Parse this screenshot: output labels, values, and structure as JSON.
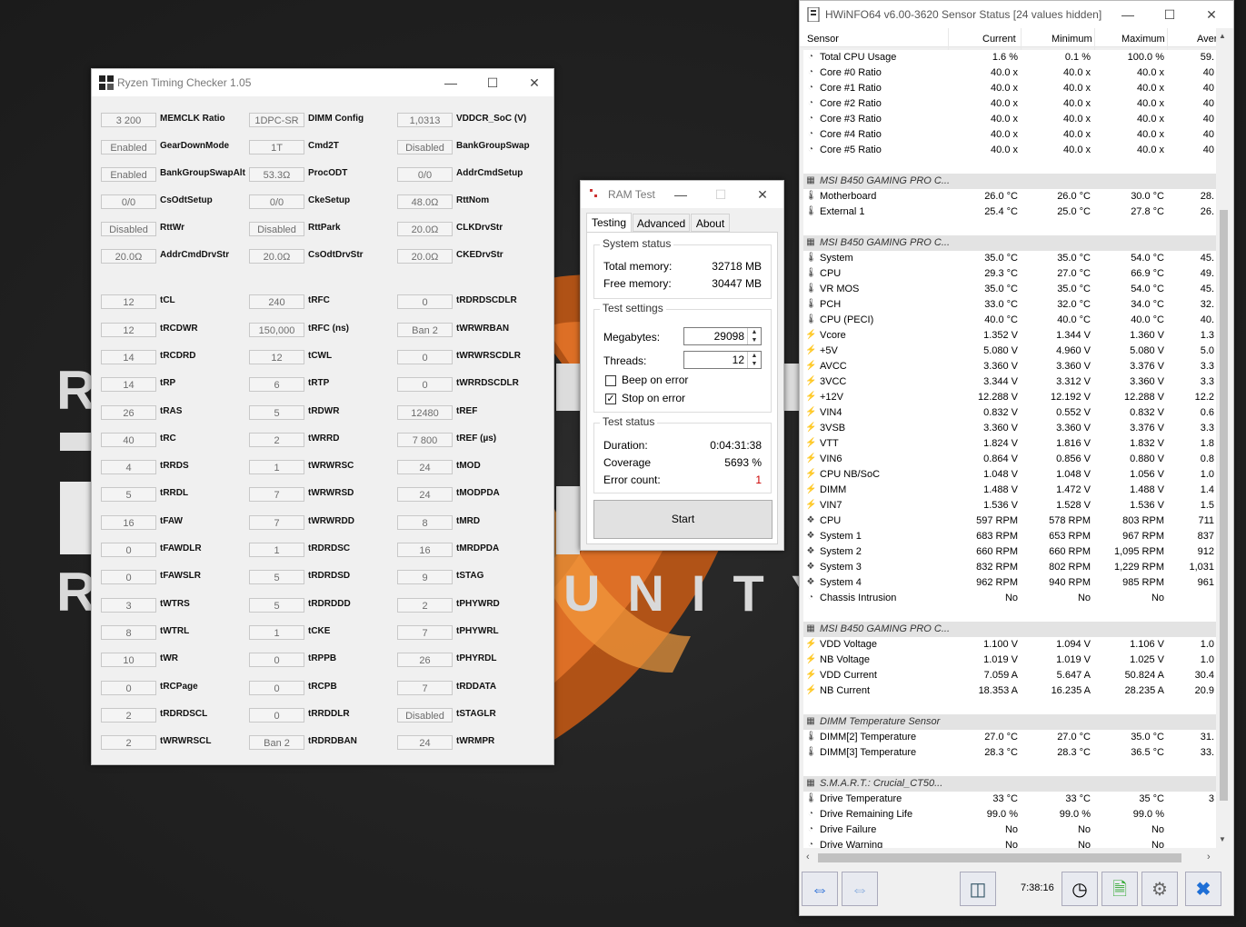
{
  "rtc": {
    "title": "Ryzen Timing Checker 1.05",
    "cells": [
      {
        "value": "3 200",
        "label": "MEMCLK Ratio"
      },
      {
        "value": "1DPC-SR",
        "label": "DIMM Config"
      },
      {
        "value": "1,0313",
        "label": "VDDCR_SoC (V)"
      },
      {
        "value": "Enabled",
        "label": "GearDownMode"
      },
      {
        "value": "1T",
        "label": "Cmd2T"
      },
      {
        "value": "Disabled",
        "label": "BankGroupSwap"
      },
      {
        "value": "Enabled",
        "label": "BankGroupSwapAlt"
      },
      {
        "value": "53.3Ω",
        "label": "ProcODT"
      },
      {
        "value": "0/0",
        "label": "AddrCmdSetup"
      },
      {
        "value": "0/0",
        "label": "CsOdtSetup"
      },
      {
        "value": "0/0",
        "label": "CkeSetup"
      },
      {
        "value": "48.0Ω",
        "label": "RttNom"
      },
      {
        "value": "Disabled",
        "label": "RttWr"
      },
      {
        "value": "Disabled",
        "label": "RttPark"
      },
      {
        "value": "20.0Ω",
        "label": "CLKDrvStr"
      },
      {
        "value": "20.0Ω",
        "label": "AddrCmdDrvStr"
      },
      {
        "value": "20.0Ω",
        "label": "CsOdtDrvStr"
      },
      {
        "value": "20.0Ω",
        "label": "CKEDrvStr"
      },
      {
        "value": "12",
        "label": "tCL"
      },
      {
        "value": "240",
        "label": "tRFC"
      },
      {
        "value": "0",
        "label": "tRDRDSCDLR"
      },
      {
        "value": "12",
        "label": "tRCDWR"
      },
      {
        "value": "150,000",
        "label": "tRFC (ns)"
      },
      {
        "value": "Ban 2",
        "label": "tWRWRBAN"
      },
      {
        "value": "14",
        "label": "tRCDRD"
      },
      {
        "value": "12",
        "label": "tCWL"
      },
      {
        "value": "0",
        "label": "tWRWRSCDLR"
      },
      {
        "value": "14",
        "label": "tRP"
      },
      {
        "value": "6",
        "label": "tRTP"
      },
      {
        "value": "0",
        "label": "tWRRDSCDLR"
      },
      {
        "value": "26",
        "label": "tRAS"
      },
      {
        "value": "5",
        "label": "tRDWR"
      },
      {
        "value": "12480",
        "label": "tREF"
      },
      {
        "value": "40",
        "label": "tRC"
      },
      {
        "value": "2",
        "label": "tWRRD"
      },
      {
        "value": "7 800",
        "label": "tREF (µs)"
      },
      {
        "value": "4",
        "label": "tRRDS"
      },
      {
        "value": "1",
        "label": "tWRWRSC"
      },
      {
        "value": "24",
        "label": "tMOD"
      },
      {
        "value": "5",
        "label": "tRRDL"
      },
      {
        "value": "7",
        "label": "tWRWRSD"
      },
      {
        "value": "24",
        "label": "tMODPDA"
      },
      {
        "value": "16",
        "label": "tFAW"
      },
      {
        "value": "7",
        "label": "tWRWRDD"
      },
      {
        "value": "8",
        "label": "tMRD"
      },
      {
        "value": "0",
        "label": "tFAWDLR"
      },
      {
        "value": "1",
        "label": "tRDRDSC"
      },
      {
        "value": "16",
        "label": "tMRDPDA"
      },
      {
        "value": "0",
        "label": "tFAWSLR"
      },
      {
        "value": "5",
        "label": "tRDRDSD"
      },
      {
        "value": "9",
        "label": "tSTAG"
      },
      {
        "value": "3",
        "label": "tWTRS"
      },
      {
        "value": "5",
        "label": "tRDRDDD"
      },
      {
        "value": "2",
        "label": "tPHYWRD"
      },
      {
        "value": "8",
        "label": "tWTRL"
      },
      {
        "value": "1",
        "label": "tCKE"
      },
      {
        "value": "7",
        "label": "tPHYWRL"
      },
      {
        "value": "10",
        "label": "tWR"
      },
      {
        "value": "0",
        "label": "tRPPB"
      },
      {
        "value": "26",
        "label": "tPHYRDL"
      },
      {
        "value": "0",
        "label": "tRCPage"
      },
      {
        "value": "0",
        "label": "tRCPB"
      },
      {
        "value": "7",
        "label": "tRDDATA"
      },
      {
        "value": "2",
        "label": "tRDRDSCL"
      },
      {
        "value": "0",
        "label": "tRRDDLR"
      },
      {
        "value": "Disabled",
        "label": "tSTAGLR"
      },
      {
        "value": "2",
        "label": "tWRWRSCL"
      },
      {
        "value": "Ban 2",
        "label": "tRDRDBAN"
      },
      {
        "value": "24",
        "label": "tWRMPR"
      }
    ]
  },
  "ramtest": {
    "title": "RAM Test",
    "tabs": [
      "Testing",
      "Advanced",
      "About"
    ],
    "system_status": {
      "title": "System status",
      "total_label": "Total memory:",
      "total": "32718 MB",
      "free_label": "Free memory:",
      "free": "30447 MB"
    },
    "settings": {
      "title": "Test settings",
      "mb_label": "Megabytes:",
      "mb": "29098",
      "threads_label": "Threads:",
      "threads": "12",
      "beep": "Beep on error",
      "stop": "Stop on error"
    },
    "test_status": {
      "title": "Test status",
      "duration_label": "Duration:",
      "duration": "0:04:31:38",
      "coverage_label": "Coverage",
      "coverage": "5693 %",
      "errors_label": "Error count:",
      "errors": "1"
    },
    "start": "Start"
  },
  "hwinfo": {
    "title": "HWiNFO64 v6.00-3620 Sensor Status [24 values hidden]",
    "columns": [
      "Sensor",
      "Current",
      "Minimum",
      "Maximum",
      "Aver"
    ],
    "time": "7:38:16",
    "rows": [
      {
        "t": "gauge",
        "n": "Total CPU Usage",
        "c": "1.6 %",
        "mi": "0.1 %",
        "ma": "100.0 %",
        "a": "59."
      },
      {
        "t": "gauge",
        "n": "Core #0 Ratio",
        "c": "40.0 x",
        "mi": "40.0 x",
        "ma": "40.0 x",
        "a": "40"
      },
      {
        "t": "gauge",
        "n": "Core #1 Ratio",
        "c": "40.0 x",
        "mi": "40.0 x",
        "ma": "40.0 x",
        "a": "40"
      },
      {
        "t": "gauge",
        "n": "Core #2 Ratio",
        "c": "40.0 x",
        "mi": "40.0 x",
        "ma": "40.0 x",
        "a": "40"
      },
      {
        "t": "gauge",
        "n": "Core #3 Ratio",
        "c": "40.0 x",
        "mi": "40.0 x",
        "ma": "40.0 x",
        "a": "40"
      },
      {
        "t": "gauge",
        "n": "Core #4 Ratio",
        "c": "40.0 x",
        "mi": "40.0 x",
        "ma": "40.0 x",
        "a": "40"
      },
      {
        "t": "gauge",
        "n": "Core #5 Ratio",
        "c": "40.0 x",
        "mi": "40.0 x",
        "ma": "40.0 x",
        "a": "40"
      },
      {
        "t": "blank"
      },
      {
        "t": "hdr",
        "n": "MSI B450 GAMING PRO C..."
      },
      {
        "t": "temp",
        "n": "Motherboard",
        "c": "26.0 °C",
        "mi": "26.0 °C",
        "ma": "30.0 °C",
        "a": "28."
      },
      {
        "t": "temp",
        "n": "External 1",
        "c": "25.4 °C",
        "mi": "25.0 °C",
        "ma": "27.8 °C",
        "a": "26."
      },
      {
        "t": "blank"
      },
      {
        "t": "hdr",
        "n": "MSI B450 GAMING PRO C..."
      },
      {
        "t": "temp",
        "n": "System",
        "c": "35.0 °C",
        "mi": "35.0 °C",
        "ma": "54.0 °C",
        "a": "45."
      },
      {
        "t": "temp",
        "n": "CPU",
        "c": "29.3 °C",
        "mi": "27.0 °C",
        "ma": "66.9 °C",
        "a": "49."
      },
      {
        "t": "temp",
        "n": "VR MOS",
        "c": "35.0 °C",
        "mi": "35.0 °C",
        "ma": "54.0 °C",
        "a": "45."
      },
      {
        "t": "temp",
        "n": "PCH",
        "c": "33.0 °C",
        "mi": "32.0 °C",
        "ma": "34.0 °C",
        "a": "32."
      },
      {
        "t": "temp",
        "n": "CPU (PECI)",
        "c": "40.0 °C",
        "mi": "40.0 °C",
        "ma": "40.0 °C",
        "a": "40."
      },
      {
        "t": "volt",
        "n": "Vcore",
        "c": "1.352 V",
        "mi": "1.344 V",
        "ma": "1.360 V",
        "a": "1.3"
      },
      {
        "t": "volt",
        "n": "+5V",
        "c": "5.080 V",
        "mi": "4.960 V",
        "ma": "5.080 V",
        "a": "5.0"
      },
      {
        "t": "volt",
        "n": "AVCC",
        "c": "3.360 V",
        "mi": "3.360 V",
        "ma": "3.376 V",
        "a": "3.3"
      },
      {
        "t": "volt",
        "n": "3VCC",
        "c": "3.344 V",
        "mi": "3.312 V",
        "ma": "3.360 V",
        "a": "3.3"
      },
      {
        "t": "volt",
        "n": "+12V",
        "c": "12.288 V",
        "mi": "12.192 V",
        "ma": "12.288 V",
        "a": "12.2"
      },
      {
        "t": "volt",
        "n": "VIN4",
        "c": "0.832 V",
        "mi": "0.552 V",
        "ma": "0.832 V",
        "a": "0.6"
      },
      {
        "t": "volt",
        "n": "3VSB",
        "c": "3.360 V",
        "mi": "3.360 V",
        "ma": "3.376 V",
        "a": "3.3"
      },
      {
        "t": "volt",
        "n": "VTT",
        "c": "1.824 V",
        "mi": "1.816 V",
        "ma": "1.832 V",
        "a": "1.8"
      },
      {
        "t": "volt",
        "n": "VIN6",
        "c": "0.864 V",
        "mi": "0.856 V",
        "ma": "0.880 V",
        "a": "0.8"
      },
      {
        "t": "volt",
        "n": "CPU NB/SoC",
        "c": "1.048 V",
        "mi": "1.048 V",
        "ma": "1.056 V",
        "a": "1.0"
      },
      {
        "t": "volt",
        "n": "DIMM",
        "c": "1.488 V",
        "mi": "1.472 V",
        "ma": "1.488 V",
        "a": "1.4"
      },
      {
        "t": "volt",
        "n": "VIN7",
        "c": "1.536 V",
        "mi": "1.528 V",
        "ma": "1.536 V",
        "a": "1.5"
      },
      {
        "t": "fan",
        "n": "CPU",
        "c": "597 RPM",
        "mi": "578 RPM",
        "ma": "803 RPM",
        "a": "711"
      },
      {
        "t": "fan",
        "n": "System 1",
        "c": "683 RPM",
        "mi": "653 RPM",
        "ma": "967 RPM",
        "a": "837"
      },
      {
        "t": "fan",
        "n": "System 2",
        "c": "660 RPM",
        "mi": "660 RPM",
        "ma": "1,095 RPM",
        "a": "912"
      },
      {
        "t": "fan",
        "n": "System 3",
        "c": "832 RPM",
        "mi": "802 RPM",
        "ma": "1,229 RPM",
        "a": "1,031"
      },
      {
        "t": "fan",
        "n": "System 4",
        "c": "962 RPM",
        "mi": "940 RPM",
        "ma": "985 RPM",
        "a": "961"
      },
      {
        "t": "gauge",
        "n": "Chassis Intrusion",
        "c": "No",
        "mi": "No",
        "ma": "No",
        "a": ""
      },
      {
        "t": "blank"
      },
      {
        "t": "hdr",
        "n": "MSI B450 GAMING PRO C..."
      },
      {
        "t": "volt",
        "n": "VDD Voltage",
        "c": "1.100 V",
        "mi": "1.094 V",
        "ma": "1.106 V",
        "a": "1.0"
      },
      {
        "t": "volt",
        "n": "NB Voltage",
        "c": "1.019 V",
        "mi": "1.019 V",
        "ma": "1.025 V",
        "a": "1.0"
      },
      {
        "t": "volt",
        "n": "VDD Current",
        "c": "7.059 A",
        "mi": "5.647 A",
        "ma": "50.824 A",
        "a": "30.4"
      },
      {
        "t": "volt",
        "n": "NB Current",
        "c": "18.353 A",
        "mi": "16.235 A",
        "ma": "28.235 A",
        "a": "20.9"
      },
      {
        "t": "blank"
      },
      {
        "t": "hdr",
        "n": "DIMM Temperature Sensor"
      },
      {
        "t": "temp",
        "n": "DIMM[2] Temperature",
        "c": "27.0 °C",
        "mi": "27.0 °C",
        "ma": "35.0 °C",
        "a": "31."
      },
      {
        "t": "temp",
        "n": "DIMM[3] Temperature",
        "c": "28.3 °C",
        "mi": "28.3 °C",
        "ma": "36.5 °C",
        "a": "33."
      },
      {
        "t": "blank"
      },
      {
        "t": "hdr",
        "n": "S.M.A.R.T.: Crucial_CT50..."
      },
      {
        "t": "temp",
        "n": "Drive Temperature",
        "c": "33 °C",
        "mi": "33 °C",
        "ma": "35 °C",
        "a": "3"
      },
      {
        "t": "gauge",
        "n": "Drive Remaining Life",
        "c": "99.0 %",
        "mi": "99.0 %",
        "ma": "99.0 %",
        "a": ""
      },
      {
        "t": "gauge",
        "n": "Drive Failure",
        "c": "No",
        "mi": "No",
        "ma": "No",
        "a": ""
      },
      {
        "t": "gauge",
        "n": "Drive Warning",
        "c": "No",
        "mi": "No",
        "ma": "No",
        "a": ""
      }
    ]
  },
  "background_text": {
    "line1": "R",
    "line3": "R   U N I T Y"
  }
}
